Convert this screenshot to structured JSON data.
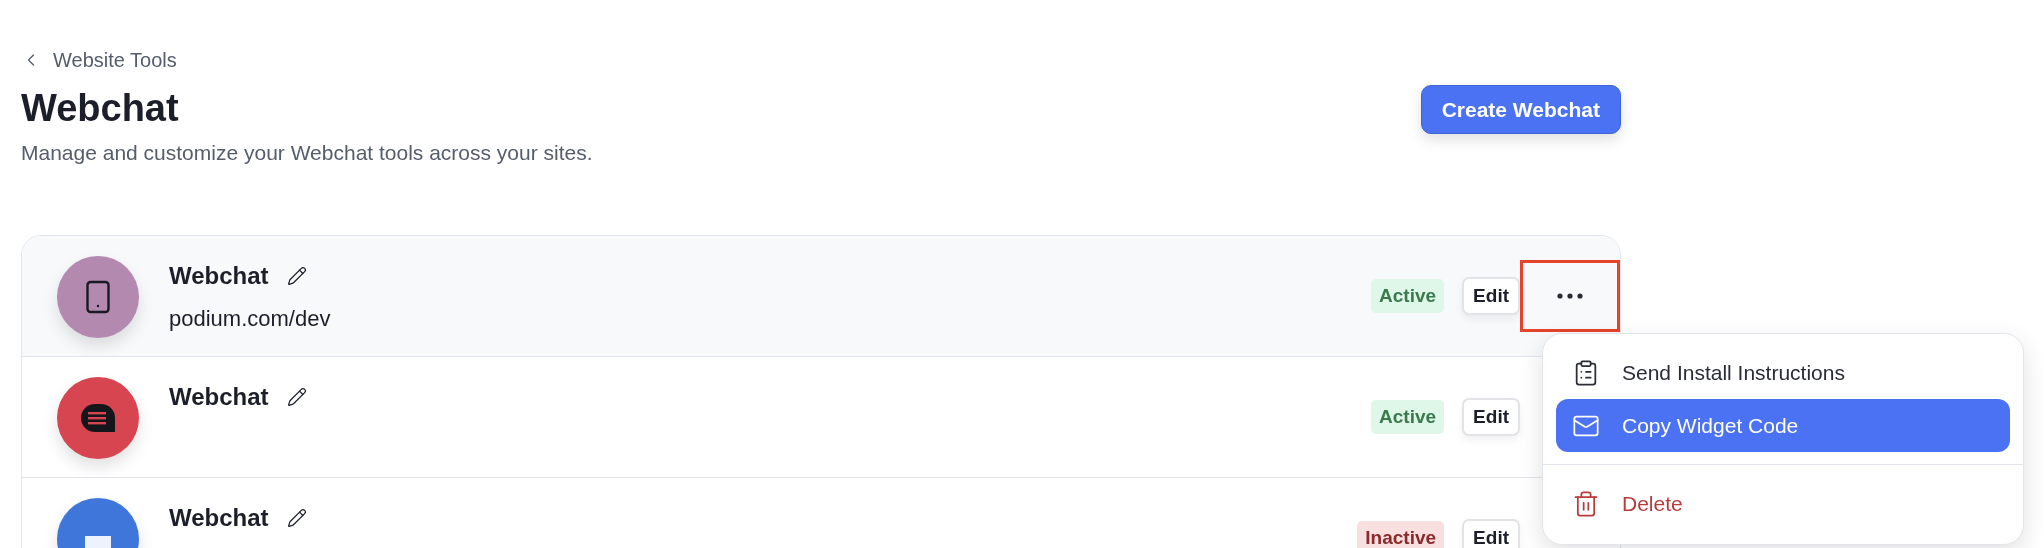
{
  "breadcrumb": {
    "label": "Website Tools"
  },
  "header": {
    "title": "Webchat",
    "subtitle": "Manage and customize your Webchat tools across your sites.",
    "button": "Create Webchat"
  },
  "rows": [
    {
      "name": "Webchat",
      "url": "podium.com/dev",
      "color": "#b389b0",
      "kind": "phone",
      "status": {
        "label": "Active",
        "kind": "active"
      },
      "edit": "Edit",
      "menu_open": true,
      "highlighted": true
    },
    {
      "name": "Webchat",
      "color": "#d64550",
      "kind": "chat",
      "status": {
        "label": "Active",
        "kind": "active"
      },
      "edit": "Edit",
      "menu_open": false,
      "highlighted": false
    },
    {
      "name": "Webchat",
      "color": "#3f76d9",
      "kind": "flag",
      "status": {
        "label": "Inactive",
        "kind": "inactive"
      },
      "edit": "Edit",
      "menu_open": false,
      "highlighted": false
    }
  ],
  "menu": {
    "items": [
      {
        "label": "Send Install Instructions",
        "kind": "clipboard",
        "selected": false
      },
      {
        "label": "Copy Widget Code",
        "kind": "mail",
        "selected": true
      },
      {
        "label": "Delete",
        "kind": "delete",
        "selected": false
      }
    ]
  }
}
